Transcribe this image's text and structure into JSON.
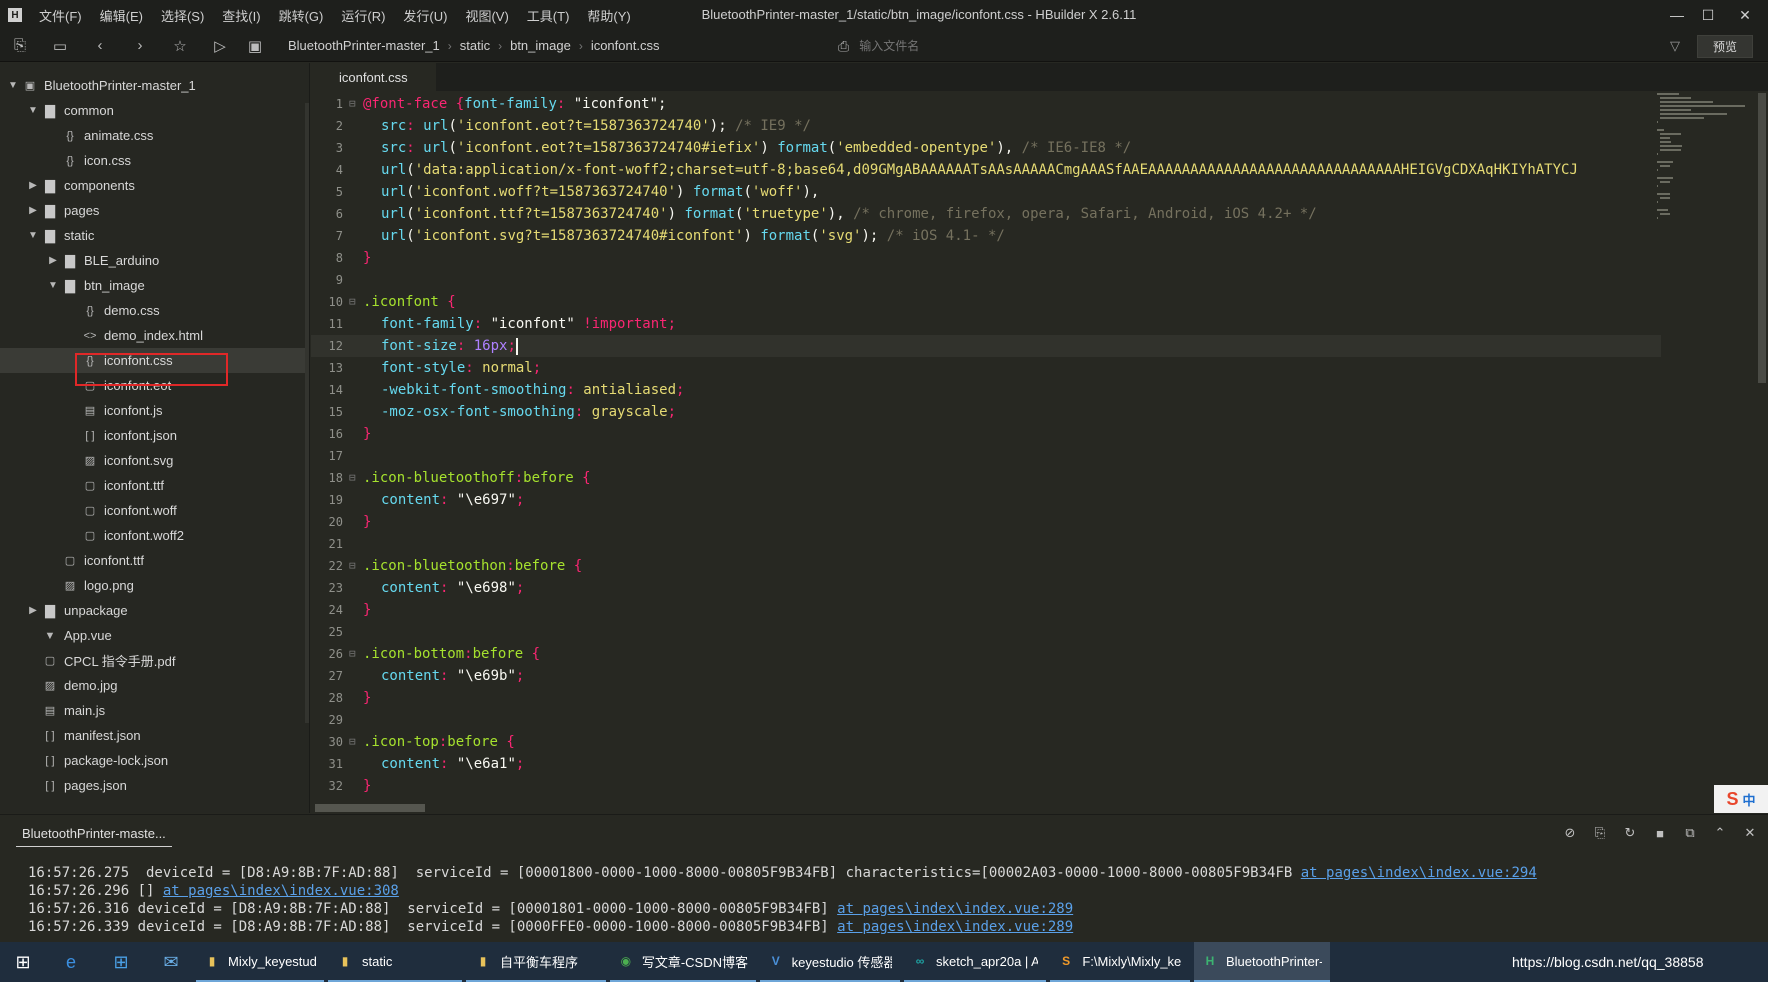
{
  "window": {
    "title": "BluetoothPrinter-master_1/static/btn_image/iconfont.css - HBuilder X 2.6.11",
    "logo": "H",
    "minimize": "—",
    "maximize": "☐",
    "close": "✕"
  },
  "menu": [
    "文件(F)",
    "编辑(E)",
    "选择(S)",
    "查找(I)",
    "跳转(G)",
    "运行(R)",
    "发行(U)",
    "视图(V)",
    "工具(T)",
    "帮助(Y)"
  ],
  "toolbar": {
    "breadcrumbs": [
      "BluetoothPrinter-master_1",
      "static",
      "btn_image",
      "iconfont.css"
    ],
    "file_search_placeholder": "输入文件名",
    "preview_label": "预览"
  },
  "sidebar": {
    "items": [
      {
        "label": "BluetoothPrinter-master_1",
        "arrow": "▼",
        "icon": "▣"
      },
      {
        "label": "common",
        "arrow": "▼",
        "icon": "▇"
      },
      {
        "label": "animate.css",
        "arrow": "",
        "icon": "{}"
      },
      {
        "label": "icon.css",
        "arrow": "",
        "icon": "{}"
      },
      {
        "label": "components",
        "arrow": "▶",
        "icon": "▇"
      },
      {
        "label": "pages",
        "arrow": "▶",
        "icon": "▇"
      },
      {
        "label": "static",
        "arrow": "▼",
        "icon": "▇"
      },
      {
        "label": "BLE_arduino",
        "arrow": "▶",
        "icon": "▇"
      },
      {
        "label": "btn_image",
        "arrow": "▼",
        "icon": "▇"
      },
      {
        "label": "demo.css",
        "arrow": "",
        "icon": "{}"
      },
      {
        "label": "demo_index.html",
        "arrow": "",
        "icon": "<>"
      },
      {
        "label": "iconfont.css",
        "arrow": "",
        "icon": "{}"
      },
      {
        "label": "iconfont.eot",
        "arrow": "",
        "icon": "▢"
      },
      {
        "label": "iconfont.js",
        "arrow": "",
        "icon": "▤"
      },
      {
        "label": "iconfont.json",
        "arrow": "",
        "icon": "[ ]"
      },
      {
        "label": "iconfont.svg",
        "arrow": "",
        "icon": "▨"
      },
      {
        "label": "iconfont.ttf",
        "arrow": "",
        "icon": "▢"
      },
      {
        "label": "iconfont.woff",
        "arrow": "",
        "icon": "▢"
      },
      {
        "label": "iconfont.woff2",
        "arrow": "",
        "icon": "▢"
      },
      {
        "label": "iconfont.ttf",
        "arrow": "",
        "icon": "▢"
      },
      {
        "label": "logo.png",
        "arrow": "",
        "icon": "▨"
      },
      {
        "label": "unpackage",
        "arrow": "▶",
        "icon": "▇"
      },
      {
        "label": "App.vue",
        "arrow": "",
        "icon": "▼"
      },
      {
        "label": "CPCL 指令手册.pdf",
        "arrow": "",
        "icon": "▢"
      },
      {
        "label": "demo.jpg",
        "arrow": "",
        "icon": "▨"
      },
      {
        "label": "main.js",
        "arrow": "",
        "icon": "▤"
      },
      {
        "label": "manifest.json",
        "arrow": "",
        "icon": "[ ]"
      },
      {
        "label": "package-lock.json",
        "arrow": "",
        "icon": "[ ]"
      },
      {
        "label": "pages.json",
        "arrow": "",
        "icon": "[ ]"
      }
    ]
  },
  "editor": {
    "tab": "iconfont.css",
    "current_line": 12,
    "lines": [
      {
        "n": "1",
        "fold": "⊟",
        "parts": [
          {
            "c": "at",
            "t": "@font-face "
          },
          {
            "c": "brace",
            "t": "{"
          },
          {
            "c": "prop",
            "t": "font-family"
          },
          {
            "c": "colon",
            "t": ": "
          },
          {
            "c": "strw",
            "t": "\"iconfont\""
          },
          {
            "c": "strw",
            "t": ";"
          }
        ]
      },
      {
        "n": "2",
        "fold": "",
        "indent": 1,
        "parts": [
          {
            "c": "prop",
            "t": "src"
          },
          {
            "c": "colon",
            "t": ": "
          },
          {
            "c": "fn",
            "t": "url"
          },
          {
            "c": "strw",
            "t": "("
          },
          {
            "c": "str",
            "t": "'iconfont.eot?t=1587363724740'"
          },
          {
            "c": "strw",
            "t": "); "
          },
          {
            "c": "cm",
            "t": "/* IE9 */"
          }
        ]
      },
      {
        "n": "3",
        "fold": "",
        "indent": 1,
        "parts": [
          {
            "c": "prop",
            "t": "src"
          },
          {
            "c": "colon",
            "t": ": "
          },
          {
            "c": "fn",
            "t": "url"
          },
          {
            "c": "strw",
            "t": "("
          },
          {
            "c": "str",
            "t": "'iconfont.eot?t=1587363724740#iefix'"
          },
          {
            "c": "strw",
            "t": ") "
          },
          {
            "c": "fn",
            "t": "format"
          },
          {
            "c": "strw",
            "t": "("
          },
          {
            "c": "str",
            "t": "'embedded-opentype'"
          },
          {
            "c": "strw",
            "t": "), "
          },
          {
            "c": "cm",
            "t": "/* IE6-IE8 */"
          }
        ]
      },
      {
        "n": "4",
        "fold": "",
        "indent": 1,
        "parts": [
          {
            "c": "fn",
            "t": "url"
          },
          {
            "c": "strw",
            "t": "("
          },
          {
            "c": "str",
            "t": "'data:application/x-font-woff2;charset=utf-8;base64,d09GMgABAAAAAATsAAsAAAAACmgAAASfAAEAAAAAAAAAAAAAAAAAAAAAAAAAAAAAAHEIGVgCDXAqHKIYhATYCJ"
          }
        ]
      },
      {
        "n": "5",
        "fold": "",
        "indent": 1,
        "parts": [
          {
            "c": "fn",
            "t": "url"
          },
          {
            "c": "strw",
            "t": "("
          },
          {
            "c": "str",
            "t": "'iconfont.woff?t=1587363724740'"
          },
          {
            "c": "strw",
            "t": ") "
          },
          {
            "c": "fn",
            "t": "format"
          },
          {
            "c": "strw",
            "t": "("
          },
          {
            "c": "str",
            "t": "'woff'"
          },
          {
            "c": "strw",
            "t": "),"
          }
        ]
      },
      {
        "n": "6",
        "fold": "",
        "indent": 1,
        "parts": [
          {
            "c": "fn",
            "t": "url"
          },
          {
            "c": "strw",
            "t": "("
          },
          {
            "c": "str",
            "t": "'iconfont.ttf?t=1587363724740'"
          },
          {
            "c": "strw",
            "t": ") "
          },
          {
            "c": "fn",
            "t": "format"
          },
          {
            "c": "strw",
            "t": "("
          },
          {
            "c": "str",
            "t": "'truetype'"
          },
          {
            "c": "strw",
            "t": "), "
          },
          {
            "c": "cm",
            "t": "/* chrome, firefox, opera, Safari, Android, iOS 4.2+ */"
          }
        ]
      },
      {
        "n": "7",
        "fold": "",
        "indent": 1,
        "parts": [
          {
            "c": "fn",
            "t": "url"
          },
          {
            "c": "strw",
            "t": "("
          },
          {
            "c": "str",
            "t": "'iconfont.svg?t=1587363724740#iconfont'"
          },
          {
            "c": "strw",
            "t": ") "
          },
          {
            "c": "fn",
            "t": "format"
          },
          {
            "c": "strw",
            "t": "("
          },
          {
            "c": "str",
            "t": "'svg'"
          },
          {
            "c": "strw",
            "t": "); "
          },
          {
            "c": "cm",
            "t": "/* iOS 4.1- */"
          }
        ]
      },
      {
        "n": "8",
        "fold": "",
        "parts": [
          {
            "c": "brace",
            "t": "}"
          }
        ]
      },
      {
        "n": "9",
        "fold": "",
        "parts": []
      },
      {
        "n": "10",
        "fold": "⊟",
        "parts": [
          {
            "c": "sel",
            "t": ".iconfont "
          },
          {
            "c": "brace",
            "t": "{"
          }
        ]
      },
      {
        "n": "11",
        "fold": "",
        "indent": 1,
        "parts": [
          {
            "c": "prop",
            "t": "font-family"
          },
          {
            "c": "colon",
            "t": ": "
          },
          {
            "c": "strw",
            "t": "\"iconfont\" "
          },
          {
            "c": "kw",
            "t": "!important"
          },
          {
            "c": "colon",
            "t": ";"
          }
        ]
      },
      {
        "n": "12",
        "fold": "",
        "indent": 1,
        "caret": true,
        "parts": [
          {
            "c": "prop",
            "t": "font-size"
          },
          {
            "c": "colon",
            "t": ": "
          },
          {
            "c": "num",
            "t": "16px"
          },
          {
            "c": "colon",
            "t": ";"
          }
        ]
      },
      {
        "n": "13",
        "fold": "",
        "indent": 1,
        "parts": [
          {
            "c": "prop",
            "t": "font-style"
          },
          {
            "c": "colon",
            "t": ": "
          },
          {
            "c": "val",
            "t": "normal"
          },
          {
            "c": "colon",
            "t": ";"
          }
        ]
      },
      {
        "n": "14",
        "fold": "",
        "indent": 1,
        "parts": [
          {
            "c": "prop",
            "t": "-webkit-font-smoothing"
          },
          {
            "c": "colon",
            "t": ": "
          },
          {
            "c": "val",
            "t": "antialiased"
          },
          {
            "c": "colon",
            "t": ";"
          }
        ]
      },
      {
        "n": "15",
        "fold": "",
        "indent": 1,
        "parts": [
          {
            "c": "prop",
            "t": "-moz-osx-font-smoothing"
          },
          {
            "c": "colon",
            "t": ": "
          },
          {
            "c": "val",
            "t": "grayscale"
          },
          {
            "c": "colon",
            "t": ";"
          }
        ]
      },
      {
        "n": "16",
        "fold": "",
        "parts": [
          {
            "c": "brace",
            "t": "}"
          }
        ]
      },
      {
        "n": "17",
        "fold": "",
        "parts": []
      },
      {
        "n": "18",
        "fold": "⊟",
        "parts": [
          {
            "c": "sel",
            "t": ".icon-bluetoothoff"
          },
          {
            "c": "colon",
            "t": ":"
          },
          {
            "c": "sel",
            "t": "before "
          },
          {
            "c": "brace",
            "t": "{"
          }
        ]
      },
      {
        "n": "19",
        "fold": "",
        "indent": 1,
        "parts": [
          {
            "c": "prop",
            "t": "content"
          },
          {
            "c": "colon",
            "t": ": "
          },
          {
            "c": "strw",
            "t": "\"\\e697\""
          },
          {
            "c": "colon",
            "t": ";"
          }
        ]
      },
      {
        "n": "20",
        "fold": "",
        "parts": [
          {
            "c": "brace",
            "t": "}"
          }
        ]
      },
      {
        "n": "21",
        "fold": "",
        "parts": []
      },
      {
        "n": "22",
        "fold": "⊟",
        "parts": [
          {
            "c": "sel",
            "t": ".icon-bluetoothon"
          },
          {
            "c": "colon",
            "t": ":"
          },
          {
            "c": "sel",
            "t": "before "
          },
          {
            "c": "brace",
            "t": "{"
          }
        ]
      },
      {
        "n": "23",
        "fold": "",
        "indent": 1,
        "parts": [
          {
            "c": "prop",
            "t": "content"
          },
          {
            "c": "colon",
            "t": ": "
          },
          {
            "c": "strw",
            "t": "\"\\e698\""
          },
          {
            "c": "colon",
            "t": ";"
          }
        ]
      },
      {
        "n": "24",
        "fold": "",
        "parts": [
          {
            "c": "brace",
            "t": "}"
          }
        ]
      },
      {
        "n": "25",
        "fold": "",
        "parts": []
      },
      {
        "n": "26",
        "fold": "⊟",
        "parts": [
          {
            "c": "sel",
            "t": ".icon-bottom"
          },
          {
            "c": "colon",
            "t": ":"
          },
          {
            "c": "sel",
            "t": "before "
          },
          {
            "c": "brace",
            "t": "{"
          }
        ]
      },
      {
        "n": "27",
        "fold": "",
        "indent": 1,
        "parts": [
          {
            "c": "prop",
            "t": "content"
          },
          {
            "c": "colon",
            "t": ": "
          },
          {
            "c": "strw",
            "t": "\"\\e69b\""
          },
          {
            "c": "colon",
            "t": ";"
          }
        ]
      },
      {
        "n": "28",
        "fold": "",
        "parts": [
          {
            "c": "brace",
            "t": "}"
          }
        ]
      },
      {
        "n": "29",
        "fold": "",
        "parts": []
      },
      {
        "n": "30",
        "fold": "⊟",
        "parts": [
          {
            "c": "sel",
            "t": ".icon-top"
          },
          {
            "c": "colon",
            "t": ":"
          },
          {
            "c": "sel",
            "t": "before "
          },
          {
            "c": "brace",
            "t": "{"
          }
        ]
      },
      {
        "n": "31",
        "fold": "",
        "indent": 1,
        "parts": [
          {
            "c": "prop",
            "t": "content"
          },
          {
            "c": "colon",
            "t": ": "
          },
          {
            "c": "strw",
            "t": "\"\\e6a1\""
          },
          {
            "c": "colon",
            "t": ";"
          }
        ]
      },
      {
        "n": "32",
        "fold": "",
        "parts": [
          {
            "c": "brace",
            "t": "}"
          }
        ]
      }
    ]
  },
  "ime": {
    "logo": "S",
    "mode": "中"
  },
  "console": {
    "tab": "BluetoothPrinter-maste...",
    "lines": [
      {
        "text": "16:57:26.275  deviceId = [D8:A9:8B:7F:AD:88]  serviceId = [00001800-0000-1000-8000-00805F9B34FB] characteristics=[00002A03-0000-1000-8000-00805F9B34FB ",
        "link": "at pages\\index\\index.vue:294"
      },
      {
        "text": "16:57:26.296 [] ",
        "link": "at pages\\index\\index.vue:308"
      },
      {
        "text": "16:57:26.316 deviceId = [D8:A9:8B:7F:AD:88]  serviceId = [00001801-0000-1000-8000-00805F9B34FB] ",
        "link": "at pages\\index\\index.vue:289"
      },
      {
        "text": "16:57:26.339 deviceId = [D8:A9:8B:7F:AD:88]  serviceId = [0000FFE0-0000-1000-8000-00805F9B34FB] ",
        "link": "at pages\\index\\index.vue:289"
      }
    ]
  },
  "taskbar": {
    "start": "⊞",
    "apps": [
      {
        "label": "Mixly_keyestudio",
        "icon": "▮",
        "color": "#e8c25a"
      },
      {
        "label": "static",
        "icon": "▮",
        "color": "#e8c25a"
      },
      {
        "label": "自平衡车程序",
        "icon": "▮",
        "color": "#e8c25a"
      },
      {
        "label": "写文章-CSDN博客 ...",
        "icon": "◉",
        "color": "#4caf50"
      },
      {
        "label": "keyestudio 传感器...",
        "icon": "V",
        "color": "#4a90d9"
      },
      {
        "label": "sketch_apr20a | A...",
        "icon": "∞",
        "color": "#1fa5a5"
      },
      {
        "label": "F:\\Mixly\\Mixly_ke...",
        "icon": "S",
        "color": "#f09a2a"
      },
      {
        "label": "BluetoothPrinter-...",
        "icon": "H",
        "color": "#3cb371",
        "active": true
      }
    ],
    "tray_text": "https://blog.csdn.net/qq_38858"
  }
}
